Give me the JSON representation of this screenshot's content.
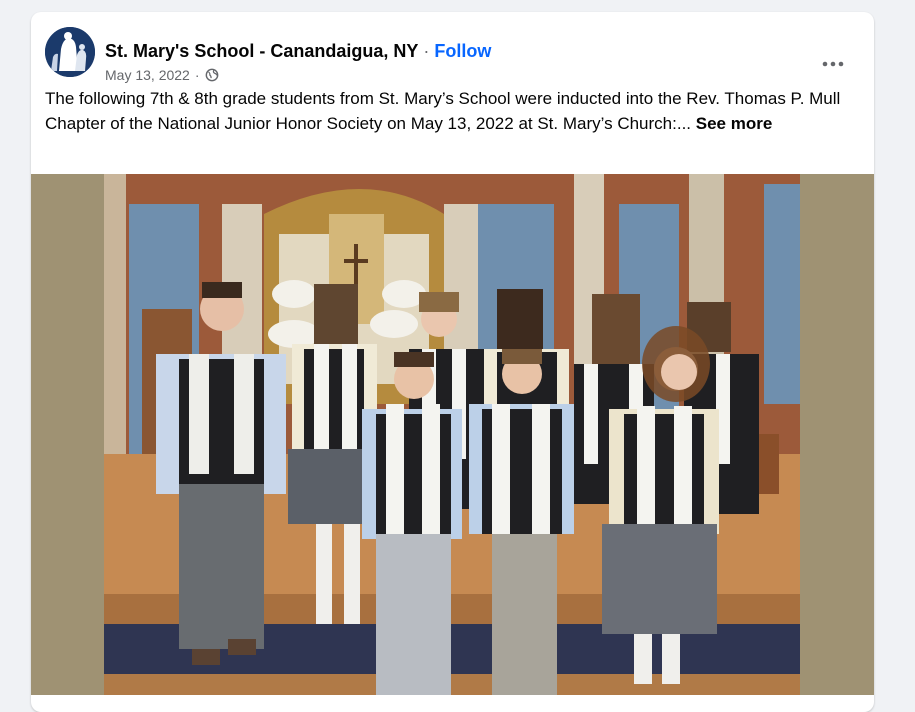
{
  "post": {
    "page_name": "St. Mary's School - Canandaigua, NY",
    "separator": "·",
    "follow_label": "Follow",
    "date": "May 13, 2022",
    "date_separator": "·",
    "audience_icon": "globe-icon",
    "more_icon": "more-options-icon",
    "text": "The following 7th & 8th grade students from St. Mary’s School were inducted into the Rev. Thomas P. Mull Chapter of the National Junior Honor Society on May 13, 2022 at St. Mary’s Church:...",
    "see_more_label": "See more",
    "photo_alt": "Students in white stoles standing in front of a church altar"
  },
  "colors": {
    "accent": "#0866ff",
    "page_bg": "#f0f2f5",
    "card_bg": "#ffffff",
    "secondary_text": "#65676b"
  }
}
